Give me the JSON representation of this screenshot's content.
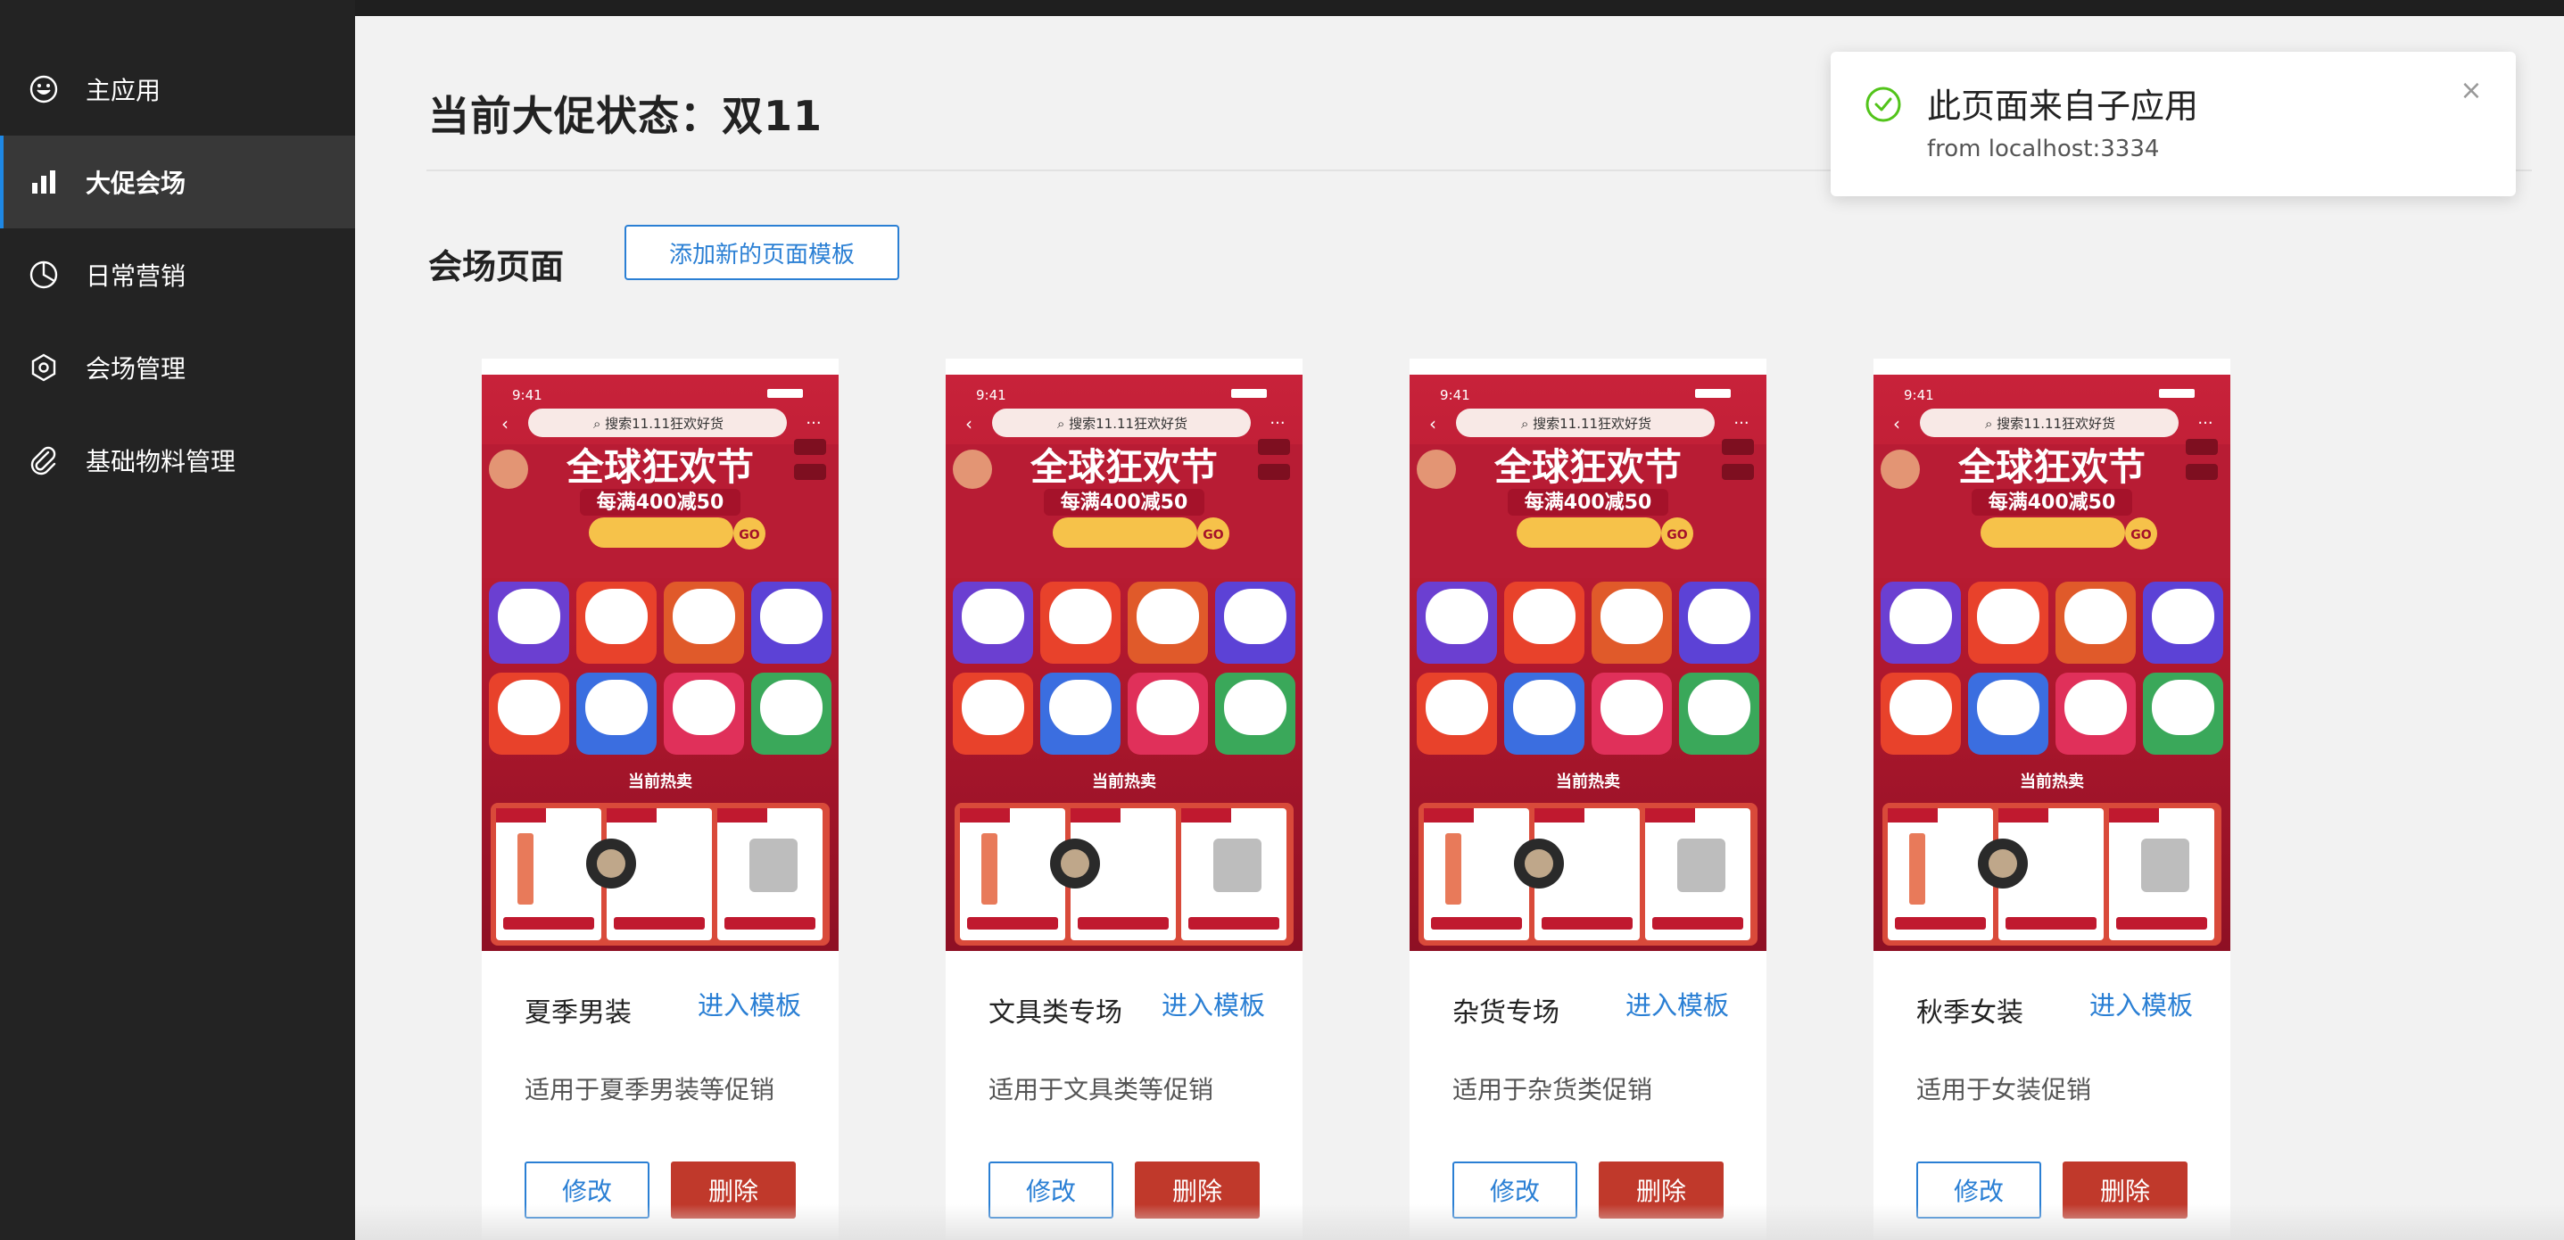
{
  "sidebar": {
    "items": [
      {
        "label": "主应用",
        "icon": "smiley-icon",
        "active": false
      },
      {
        "label": "大促会场",
        "icon": "bar-chart-icon",
        "active": true
      },
      {
        "label": "日常营销",
        "icon": "pie-chart-icon",
        "active": false
      },
      {
        "label": "会场管理",
        "icon": "hexagon-settings-icon",
        "active": false
      },
      {
        "label": "基础物料管理",
        "icon": "paperclip-icon",
        "active": false
      }
    ]
  },
  "header": {
    "title": "当前大促状态：双11"
  },
  "section": {
    "title": "会场页面",
    "add_button": "添加新的页面模板"
  },
  "preview": {
    "time": "9:41",
    "search": "搜索11.11狂欢好货",
    "banner_title": "全球狂欢节",
    "banner_sub": "每满400减50",
    "hot_label": "当前热卖"
  },
  "cards": [
    {
      "name": "夏季男装",
      "enter": "进入模板",
      "desc": "适用于夏季男装等促销",
      "edit": "修改",
      "delete": "删除"
    },
    {
      "name": "文具类专场",
      "enter": "进入模板",
      "desc": "适用于文具类等促销",
      "edit": "修改",
      "delete": "删除"
    },
    {
      "name": "杂货专场",
      "enter": "进入模板",
      "desc": "适用于杂货类促销",
      "edit": "修改",
      "delete": "删除"
    },
    {
      "name": "秋季女装",
      "enter": "进入模板",
      "desc": "适用于女装促销",
      "edit": "修改",
      "delete": "删除"
    }
  ],
  "toast": {
    "title": "此页面来自子应用",
    "subtitle": "from localhost:3334",
    "icon": "check-circle-icon"
  },
  "colors": {
    "sidebar_bg": "#232323",
    "active_item_bg": "#383838",
    "accent": "#2a7fd4",
    "danger": "#c0392b",
    "success": "#52c41a"
  }
}
